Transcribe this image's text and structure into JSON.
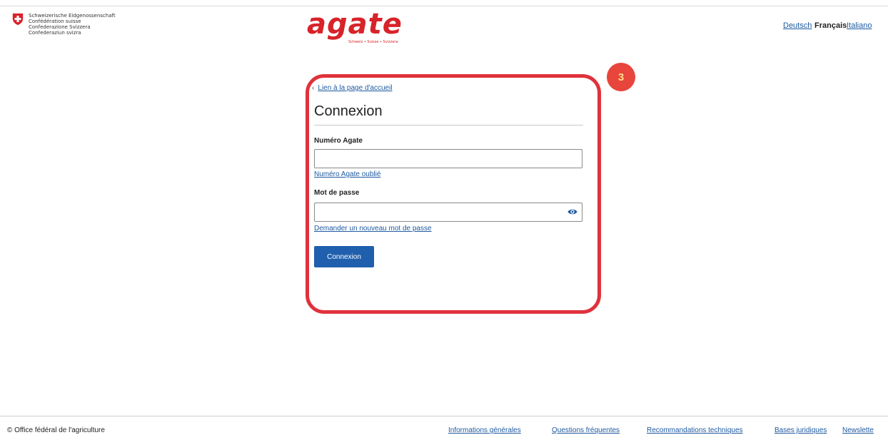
{
  "header": {
    "confederation_lines": [
      "Schweizerische Eidgenossenschaft",
      "Confédération suisse",
      "Confederazione Svizzera",
      "Confederaziun svizra"
    ],
    "brand": {
      "first_letter": "a",
      "rest": "gate",
      "subtitle": "Schweiz • Suisse • Svizzera"
    },
    "languages": {
      "de": "Deutsch",
      "fr": "Français",
      "it": "Italiano"
    }
  },
  "annotation": {
    "step": "3"
  },
  "login": {
    "back_link": "Lien à la page d'accueil",
    "title": "Connexion",
    "agate_number_label": "Numéro Agate",
    "agate_number_value": "",
    "forgot_number_link": "Numéro Agate oublié",
    "password_label": "Mot de passe",
    "password_value": "",
    "new_password_link": "Demander un nouveau mot de passe",
    "submit_label": "Connexion"
  },
  "footer": {
    "copyright": "© Office fédéral de l'agriculture",
    "links": [
      "Informations générales",
      "Questions fréquentes",
      "Recommandations techniques",
      "Bases juridiques",
      "Newslette"
    ]
  },
  "colors": {
    "brand_red": "#d8232a",
    "link_blue": "#1e5aa0",
    "button_blue": "#1f5fad",
    "highlight_red": "#e0323c"
  }
}
